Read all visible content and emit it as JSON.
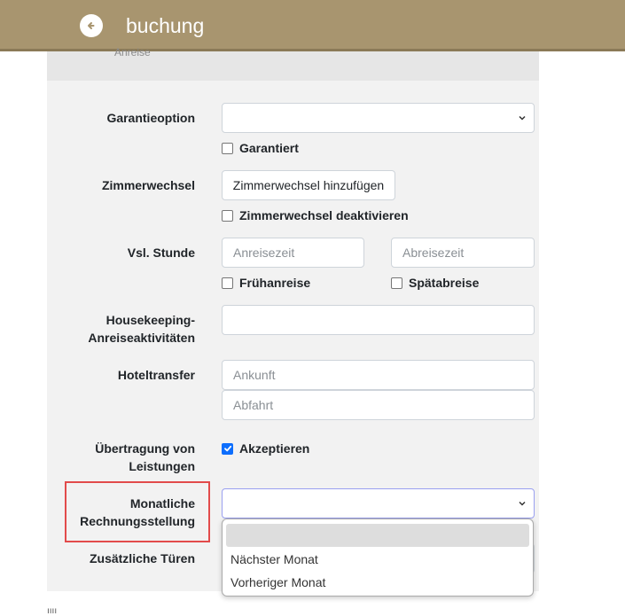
{
  "header": {
    "title": "buchung",
    "back_icon": "arrow-left-circle-icon"
  },
  "panel_cut_text": "Anreise",
  "form": {
    "guarantee": {
      "label": "Garantieoption",
      "value": "",
      "checkbox_label": "Garantiert",
      "checkbox_checked": false
    },
    "room_change": {
      "label": "Zimmerwechsel",
      "button_label": "Zimmerwechsel hinzufügen",
      "checkbox_label": "Zimmerwechsel deaktivieren",
      "checkbox_checked": false
    },
    "hour": {
      "label": "Vsl. Stunde",
      "arrival_placeholder": "Anreisezeit",
      "departure_placeholder": "Abreisezeit",
      "early_label": "Frühanreise",
      "early_checked": false,
      "late_label": "Spätabreise",
      "late_checked": false
    },
    "housekeeping": {
      "label_line1": "Housekeeping-",
      "label_line2": "Anreiseaktivitäten",
      "value": ""
    },
    "transfer": {
      "label": "Hoteltransfer",
      "arrival_placeholder": "Ankunft",
      "departure_placeholder": "Abfahrt"
    },
    "services": {
      "label_line1": "Übertragung von",
      "label_line2": "Leistungen",
      "checkbox_label": "Akzeptieren",
      "checkbox_checked": true
    },
    "billing": {
      "label_line1": "Monatliche",
      "label_line2": "Rechnungsstellung",
      "value": "",
      "options": [
        "",
        "Nächster Monat",
        "Vorheriger Monat"
      ]
    },
    "doors": {
      "label": "Zusätzliche Türen"
    }
  },
  "bottom_fragment": "ıııı"
}
